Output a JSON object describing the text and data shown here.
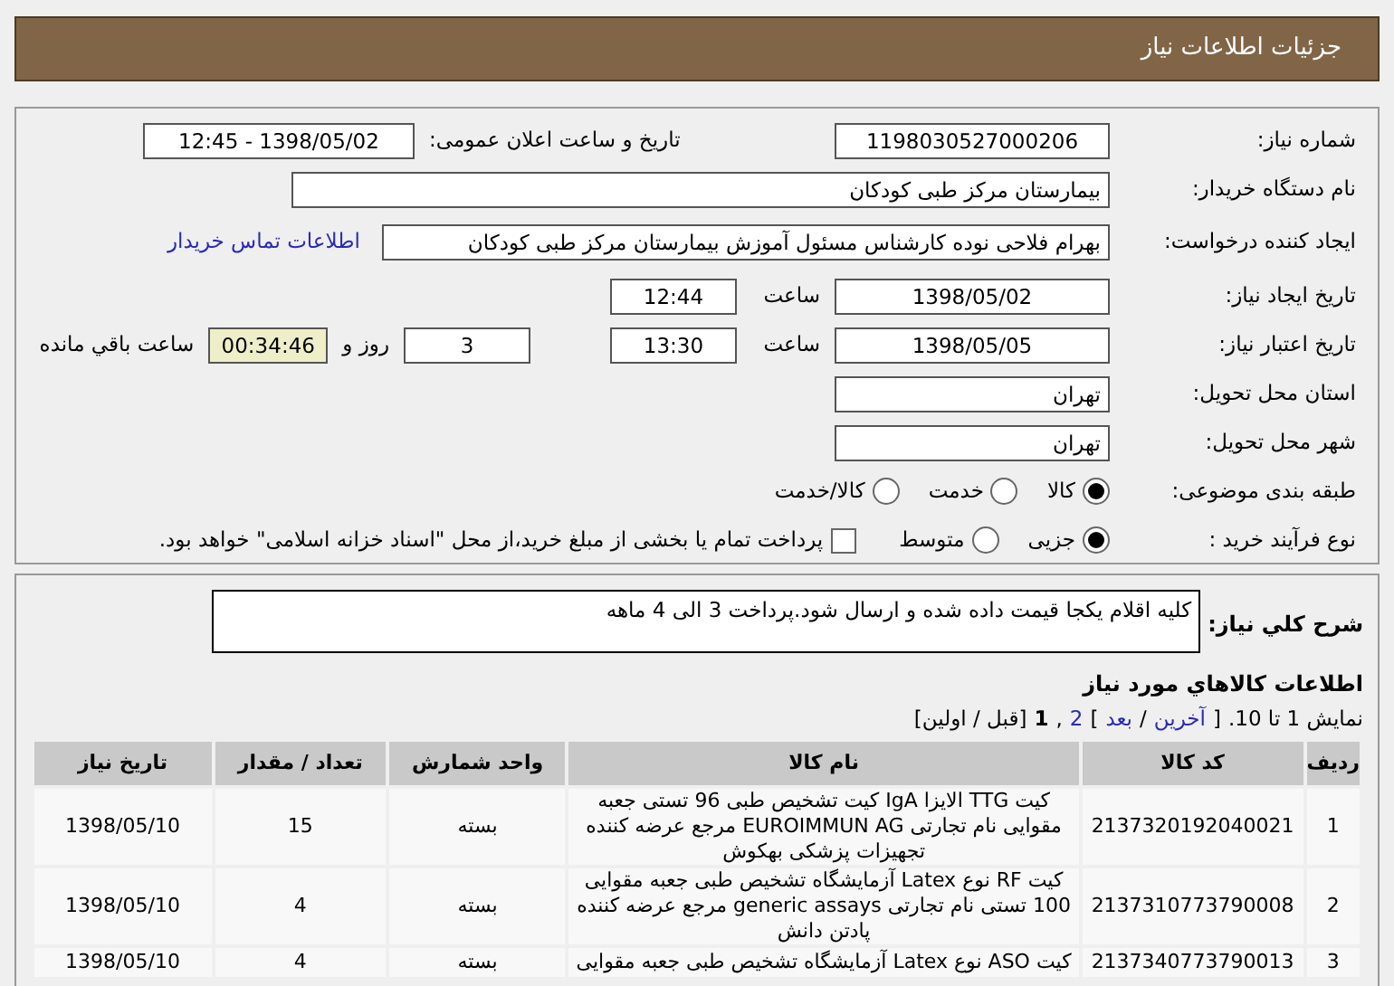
{
  "header": {
    "title": "جزئیات اطلاعات نیاز"
  },
  "form": {
    "need_number": {
      "label": "شماره نیاز:",
      "value": "1198030527000206"
    },
    "announce": {
      "label": "تاریخ و ساعت اعلان عمومی:",
      "value": "1398/05/02 - 12:45"
    },
    "buyer": {
      "label": "نام دستگاه خریدار:",
      "value": "بیمارستان مرکز طبی کودکان"
    },
    "creator": {
      "label": "ایجاد کننده درخواست:",
      "value": "بهرام فلاحی نوده کارشناس مسئول آموزش بیمارستان مرکز طبی کودکان",
      "link": "اطلاعات تماس خریدار"
    },
    "created": {
      "label": "تاریخ ایجاد نیاز:",
      "date": "1398/05/02",
      "time_label": "ساعت",
      "time": "12:44"
    },
    "validity": {
      "label": "تاریخ اعتبار نیاز:",
      "date": "1398/05/05",
      "time_label": "ساعت",
      "time": "13:30",
      "days": "3",
      "days_label": "روز و",
      "remaining": "00:34:46",
      "remaining_label": "ساعت باقي مانده"
    },
    "province": {
      "label": "استان محل تحویل:",
      "value": "تهران"
    },
    "city": {
      "label": "شهر محل تحویل:",
      "value": "تهران"
    },
    "category": {
      "label": "طبقه بندی موضوعی:",
      "options": [
        {
          "label": "کالا",
          "selected": true
        },
        {
          "label": "خدمت",
          "selected": false
        },
        {
          "label": "کالا/خدمت",
          "selected": false
        }
      ]
    },
    "process": {
      "label": "نوع فرآیند خرید :",
      "options": [
        {
          "label": "جزیی",
          "selected": true
        },
        {
          "label": "متوسط",
          "selected": false
        }
      ],
      "treasury": {
        "label": "پرداخت تمام یا بخشی از مبلغ خرید،از محل \"اسناد خزانه اسلامی\" خواهد بود.",
        "checked": false
      }
    }
  },
  "description": {
    "label": "شرح کلي نیاز:",
    "value": "کلیه اقلام یکجا قیمت داده شده و ارسال شود.پرداخت 3 الی 4 ماهه"
  },
  "goods": {
    "title": "اطلاعات کالاهاي مورد نیاز",
    "pagination": {
      "showing": "نمایش 1 تا 10.",
      "open": "[",
      "last": "آخرین",
      "slash": "/",
      "next": "بعد",
      "close": "]",
      "page_2": "2",
      "comma": ",",
      "page_1": "1",
      "prev_first": "[قبل / اولین]"
    },
    "columns": [
      "ردیف",
      "کد کالا",
      "نام کالا",
      "واحد شمارش",
      "تعداد / مقدار",
      "تاریخ نیاز"
    ],
    "rows": [
      {
        "row": "1",
        "code": "2137320192040021",
        "name": "کیت TTG الایزا IgA کیت تشخیص طبی 96 تستی جعبه مقوایی نام تجارتی EUROIMMUN AG مرجع عرضه کننده تجهیزات پزشکی بهکوش",
        "unit": "بسته",
        "quantity": "15",
        "date": "1398/05/10"
      },
      {
        "row": "2",
        "code": "2137310773790008",
        "name": "کیت RF نوع Latex آزمایشگاه تشخیص طبی جعبه مقوایی 100 تستی نام تجارتی generic assays مرجع عرضه کننده پادتن دانش",
        "unit": "بسته",
        "quantity": "4",
        "date": "1398/05/10"
      },
      {
        "row": "3",
        "code": "2137340773790013",
        "name": "کیت ASO نوع Latex آزمایشگاه تشخیص طبی جعبه مقوایی",
        "unit": "بسته",
        "quantity": "4",
        "date": "1398/05/10"
      }
    ]
  }
}
